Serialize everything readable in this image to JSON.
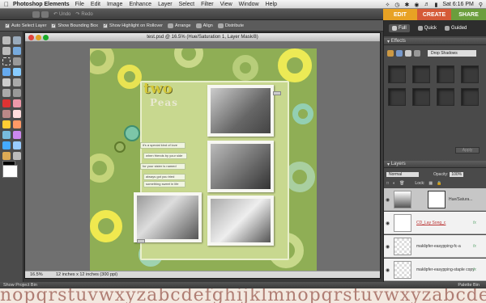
{
  "menubar": {
    "apple": "",
    "app": "Photoshop Elements",
    "items": [
      "File",
      "Edit",
      "Image",
      "Enhance",
      "Layer",
      "Select",
      "Filter",
      "View",
      "Window",
      "Help"
    ],
    "clock": "Sat 6:16 PM"
  },
  "topbar": {
    "undo": "Undo",
    "redo": "Redo"
  },
  "modes": {
    "edit": "EDIT",
    "create": "CREATE",
    "share": "SHARE"
  },
  "editmodes": {
    "full": "Full",
    "quick": "Quick",
    "guided": "Guided"
  },
  "options": {
    "auto_select": "Auto Select Layer",
    "show_bounding": "Show Bounding Box",
    "show_highlight": "Show Highlight on Rollover",
    "arrange": "Arrange",
    "align": "Align",
    "distribute": "Distribute"
  },
  "document": {
    "title": "test.psd @ 16.5% (Hue/Saturation 1, Layer Mask/8)",
    "zoom": "16.5%",
    "size": "12 inches x 12 inches (300 ppi)"
  },
  "scrapbook": {
    "title_line1": "two",
    "title_line2": "Peas",
    "journal": [
      "it's a special kind of love",
      "when friends by your side",
      "for your sister is named",
      "always got you tried",
      "something sweet in life"
    ]
  },
  "effects": {
    "header": "Effects",
    "dropdown": "Drop Shadows",
    "apply": "Apply"
  },
  "layers": {
    "header": "Layers",
    "mode": "Normal",
    "opacity_label": "Opacity:",
    "opacity": "100%",
    "lock_label": "Lock:",
    "rows": [
      {
        "name": "Hue/Satura...",
        "fx": ""
      },
      {
        "name": "CD_Lay Song_c",
        "fx": "fx"
      },
      {
        "name": "maklipfer-easypping-fc-a",
        "fx": "fx"
      },
      {
        "name": "maklipfer-easypping-staple copy",
        "fx": "fx"
      }
    ]
  },
  "bottombar": {
    "project_bin": "Show Project Bin",
    "palette_bin": "Palette Bin"
  },
  "projbin": {
    "strip": "nopqrstuvwxyzabcdefghijklmnopqrstuvwxyzabcdefghijklmno"
  },
  "colors": {
    "edit": "#e8a224",
    "create": "#d55a37",
    "share": "#6b9e3d"
  }
}
